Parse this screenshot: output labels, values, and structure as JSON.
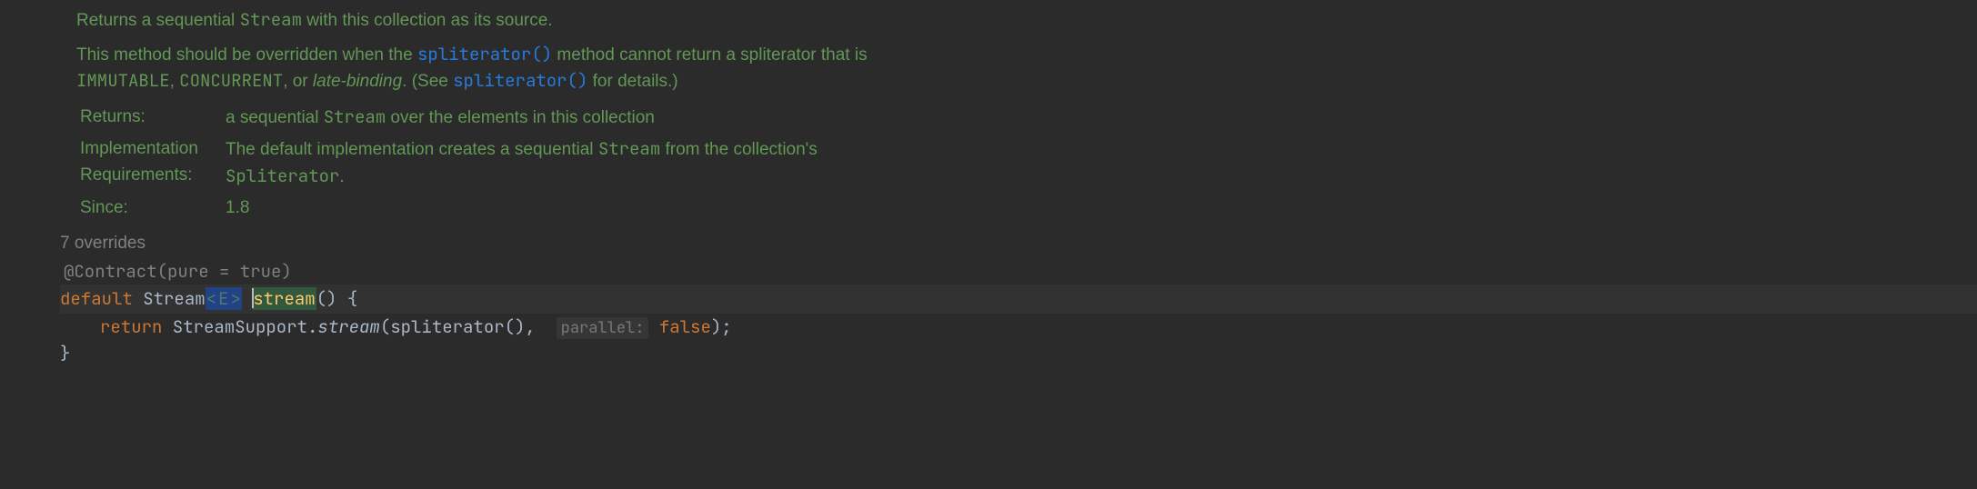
{
  "doc": {
    "summary_pre": "Returns a sequential ",
    "summary_stream": "Stream",
    "summary_post": " with this collection as its source.",
    "para_pre": "This method should be overridden when the ",
    "spliterator_link": "spliterator()",
    "para_mid": " method cannot return a spliterator that is ",
    "immutable": "IMMUTABLE",
    "sep1": ", ",
    "concurrent": "CONCURRENT",
    "sep2": ", or ",
    "late_binding": "late-binding",
    "see_pre": ". (See ",
    "spliterator_link2": "spliterator()",
    "see_post": " for details.)",
    "returns_label": "Returns:",
    "returns_pre": "a sequential ",
    "returns_stream": "Stream",
    "returns_post": " over the elements in this collection",
    "impl_label_1": "Implementation",
    "impl_label_2": "Requirements:",
    "impl_pre": "The default implementation creates a sequential ",
    "impl_stream": "Stream",
    "impl_mid": " from the collection's ",
    "impl_spliterator": "Spliterator",
    "impl_post": ".",
    "since_label": "Since:",
    "since_value": "1.8"
  },
  "overrides": "7 overrides",
  "annotation": "@Contract(pure = true)",
  "code": {
    "default_kw": "default",
    "stream_type": "Stream",
    "generic_open": "<",
    "generic_e": "E",
    "generic_close": ">",
    "method_name": "stream",
    "sig_rest": "() {",
    "return_kw": "return",
    "support": " StreamSupport.",
    "stream_method": "stream",
    "args_pre": "(spliterator(),  ",
    "hint": "parallel:",
    "false_kw": "false",
    "args_post": ");",
    "close": "}"
  }
}
